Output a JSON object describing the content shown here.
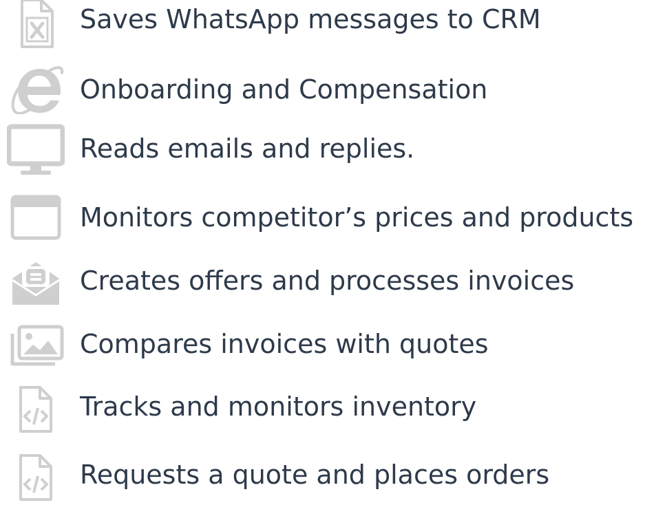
{
  "palette": {
    "icon_gray": "#cfcfcf",
    "text": "#2e3a4a"
  },
  "features": [
    {
      "icon": "excel-file-icon",
      "label": "Saves WhatsApp messages to CRM"
    },
    {
      "icon": "internet-explorer-icon",
      "label": "Onboarding and Compensation"
    },
    {
      "icon": "desktop-monitor-icon",
      "label": "Reads emails and replies."
    },
    {
      "icon": "browser-window-icon",
      "label": "Monitors competitor’s prices and products"
    },
    {
      "icon": "open-envelope-icon",
      "label": "Creates offers and processes invoices"
    },
    {
      "icon": "image-gallery-icon",
      "label": "Compares invoices with quotes"
    },
    {
      "icon": "code-file-icon",
      "label": "Tracks and monitors inventory"
    },
    {
      "icon": "code-file-icon",
      "label": "Requests a quote and places orders"
    }
  ]
}
